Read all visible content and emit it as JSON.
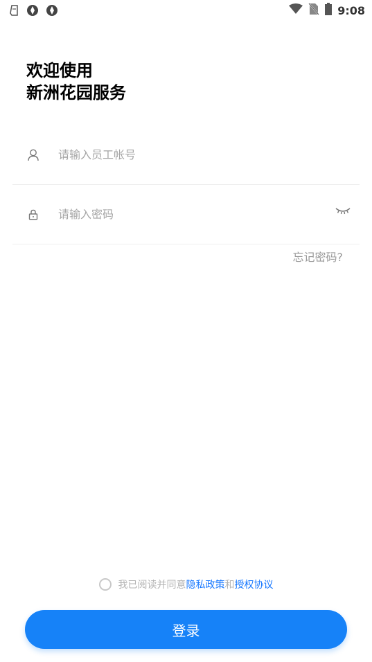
{
  "status_bar": {
    "time": "9:08",
    "left_icons": [
      "notification-icon",
      "app-icon",
      "app-icon"
    ],
    "right_icons": [
      "wifi-icon",
      "no-sim-icon",
      "battery-icon"
    ]
  },
  "welcome": {
    "line1": "欢迎使用",
    "line2": "新洲花园服务"
  },
  "form": {
    "account_placeholder": "请输入员工帐号",
    "account_value": "",
    "password_placeholder": "请输入密码",
    "password_value": "",
    "forgot_label": "忘记密码?"
  },
  "agreement": {
    "prefix": "我已阅读并同意",
    "privacy_link": "隐私政策",
    "and": "和",
    "auth_link": "授权协议"
  },
  "login_button": {
    "label": "登录"
  },
  "colors": {
    "primary": "#1682f8",
    "link": "#1677ff",
    "placeholder": "#a6a6a6",
    "muted": "#999999"
  }
}
